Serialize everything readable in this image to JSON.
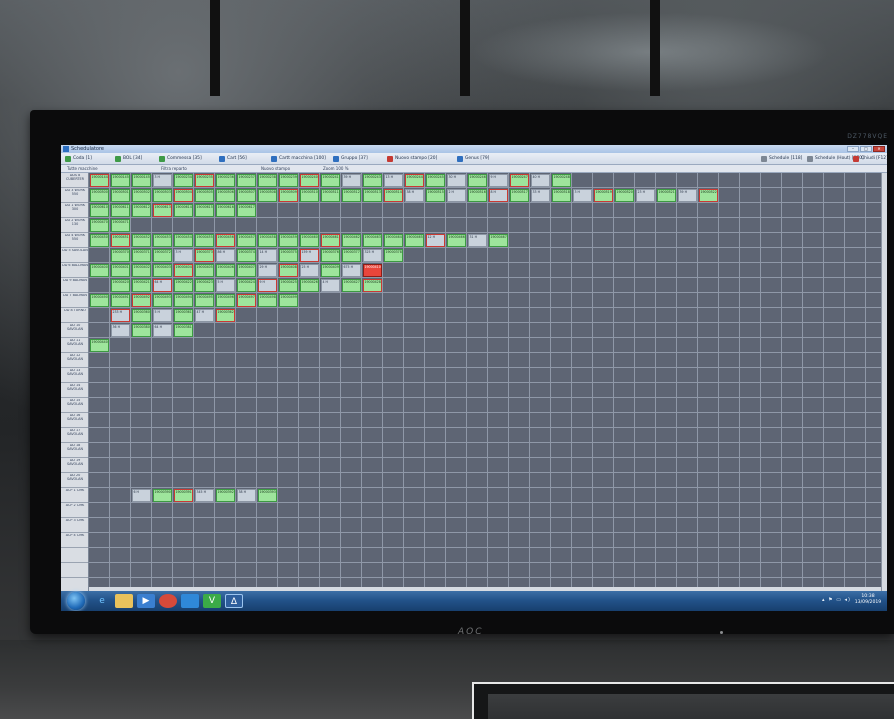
{
  "app": {
    "title": "Schedulatore",
    "window_buttons": [
      "–",
      "□",
      "✕"
    ]
  },
  "ribbon": [
    {
      "label": "Coda [1]",
      "color": "green"
    },
    {
      "label": "BOL [34]",
      "color": "green"
    },
    {
      "label": "Commessa [35]",
      "color": "green"
    },
    {
      "label": "Cart [56]",
      "color": "blue"
    },
    {
      "label": "Cartt macchina [100]",
      "color": "blue"
    },
    {
      "label": "Gruppo [37]",
      "color": "blue"
    },
    {
      "label": "Nuovo stampo [20]",
      "color": "red"
    },
    {
      "label": "Genus [79]",
      "color": "blue"
    },
    {
      "label": "Schedule [118]",
      "color": "gray"
    },
    {
      "label": "Schedule (Hout) [870]",
      "color": "gray"
    },
    {
      "label": "Chiudi [F12]",
      "color": "red"
    }
  ],
  "toolbar": {
    "machine_label": "Tutte macchine",
    "filter_label": "Filtra reparto",
    "state_label": "Nuovo stampo",
    "zoom_label": "Zoom 100 %"
  },
  "rows": [
    "DDS 8 CUBERTER",
    "DD 3 WORK 550",
    "DD 1 WORK 300",
    "DD 2 WORK 130",
    "DD 4 WORK 550",
    "DD 5 SAVOLAN",
    "DD 6 BALLMAN",
    "DD 9 BALMAN",
    "DD 7 BALMAN",
    "DD 8 TURNO",
    "DD 10 SAVOLAN",
    "DD 11 SAVOLAN",
    "DD 12 SAVOLAN",
    "DD 13 SAVOLAN",
    "DD 14 SAVOLAN",
    "DD 15 SAVOLAN",
    "DD 16 SAVOLAN",
    "DD 17 SAVOLAN",
    "DD 18 SAVOLAN",
    "DD 19 SAVOLAN",
    "DD 20 SAVOLAN",
    "ACP 1 CMK",
    "ACP 2 CMK",
    "ACP 3 CMK",
    "ACP 4 CMK"
  ],
  "jobs": [
    [
      "19000144",
      "19000145",
      "19000145",
      "3 H",
      "19000234",
      "19000235",
      "19000236",
      "19000237",
      "19000238",
      "19000239",
      "19000240",
      "19000241",
      "39 H",
      "19000243",
      "13 H",
      "19000244",
      "19000245",
      "30 H",
      "19000246",
      "9 H",
      "19000247",
      "40 H",
      "19000248"
    ],
    [
      "19000500",
      "19000501",
      "19000502",
      "19000503",
      "19000504",
      "19000505",
      "19000506",
      "19000507",
      "19000508",
      "19000509",
      "19000510",
      "19000511",
      "19000512",
      "19000513",
      "19000514",
      "38 H",
      "19000515",
      "2 H",
      "19000516",
      "8 H",
      "19000517",
      "33 H",
      "19000518",
      "3 H",
      "19000519",
      "19000520",
      "23 H",
      "19000521",
      "39 H",
      "19000522"
    ],
    [
      "19000610",
      "19000611",
      "19000612",
      "19000613",
      "19000614",
      "19000615",
      "19000616",
      "19000617"
    ],
    [
      "19000470",
      "19000471"
    ],
    [
      "19000450",
      "19000451",
      "19000452",
      "19000453",
      "19000454",
      "19000455",
      "19000456",
      "19000457",
      "19000458",
      "19000459",
      "19000460",
      "19000461",
      "19000462",
      "19000463",
      "19000464",
      "19000465",
      "12 H",
      "19000466",
      "31 H",
      "19000467"
    ],
    [
      "",
      "19000370",
      "19000371",
      "19000372",
      "3 H",
      "19000373",
      "86 H",
      "19000374",
      "14 H",
      "19000375",
      "159 H",
      "19000376",
      "19000377",
      "325 H",
      "19000378"
    ],
    [
      "19000400",
      "19000401",
      "19000402",
      "19000403",
      "19000404",
      "19000405",
      "19000406",
      "19000407",
      "29 H",
      "19000408",
      "25 H",
      "19000409",
      "675 H",
      "19000410"
    ],
    [
      "",
      "19000420",
      "19000421",
      "64 H",
      "19000422",
      "19000423",
      "5 H",
      "19000424",
      "9 H",
      "19000425",
      "19000426",
      "4 H",
      "19000427",
      "19000428"
    ],
    [
      "19000490",
      "19000491",
      "19000492",
      "19000493",
      "19000494",
      "19000495",
      "19000496",
      "19000497",
      "19000498",
      "19000499"
    ],
    [
      "",
      "233 H",
      "19000360",
      "5 H",
      "19000361",
      "47 H",
      "19000362"
    ],
    [
      "",
      "36 H",
      "19000380",
      "64 H",
      "19000381"
    ],
    [
      "19000440"
    ],
    [],
    [],
    [],
    [],
    [],
    [],
    [],
    [],
    [],
    [
      "",
      "",
      "6 H",
      "19000390",
      "19000391",
      "345 H",
      "19000392",
      "38 H",
      "19000393"
    ],
    [],
    [],
    []
  ],
  "red_jobs": [
    [
      6,
      13
    ]
  ],
  "taskbar": {
    "icons": [
      "ie-icon",
      "folder-icon",
      "media-icon",
      "chrome-icon",
      "outlook-icon",
      "excel-icon",
      "vnc-icon"
    ],
    "clock_time": "10:38",
    "clock_date": "13/09/2019"
  },
  "watermark": "DZ778VQE"
}
